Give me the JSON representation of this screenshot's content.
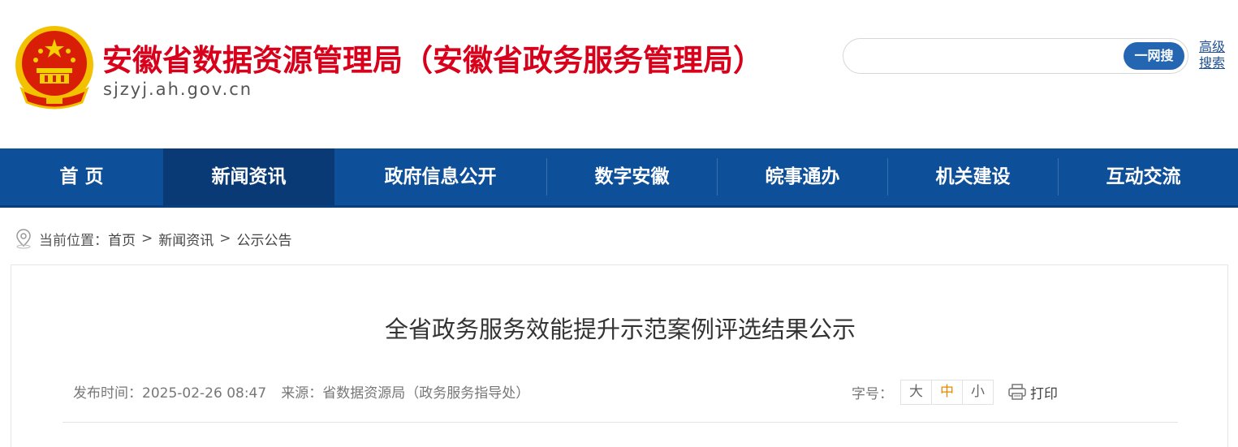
{
  "header": {
    "site_title": "安徽省数据资源管理局（安徽省政务服务管理局）",
    "site_domain": "sjzyj.ah.gov.cn",
    "emblem_icon": "national-emblem-icon",
    "search": {
      "value": "",
      "placeholder": "",
      "button_label": "一网搜",
      "advanced_label": "高级搜索"
    }
  },
  "nav": {
    "items": [
      {
        "label": "首 页"
      },
      {
        "label": "新闻资讯"
      },
      {
        "label": "政府信息公开"
      },
      {
        "label": "数字安徽"
      },
      {
        "label": "皖事通办"
      },
      {
        "label": "机关建设"
      },
      {
        "label": "互动交流"
      }
    ],
    "active_index": 1
  },
  "breadcrumb": {
    "prefix": "当前位置：",
    "items": [
      "首页",
      "新闻资讯",
      "公示公告"
    ],
    "separator": ">"
  },
  "article": {
    "title": "全省政务服务效能提升示范案例评选结果公示",
    "publish_label": "发布时间：",
    "publish_time": "2025-02-26 08:47",
    "source_label": "来源：",
    "source": "省数据资源局（政务服务指导处）",
    "font_size_label": "字号：",
    "font_sizes": [
      "大",
      "中",
      "小"
    ],
    "font_size_selected": "中",
    "print_label": "打印"
  },
  "colors": {
    "title_red": "#d8001a",
    "nav_blue": "#0e4f9a",
    "nav_active": "#0a3a75",
    "search_button": "#2566b3",
    "active_font_size": "#e68a00"
  }
}
